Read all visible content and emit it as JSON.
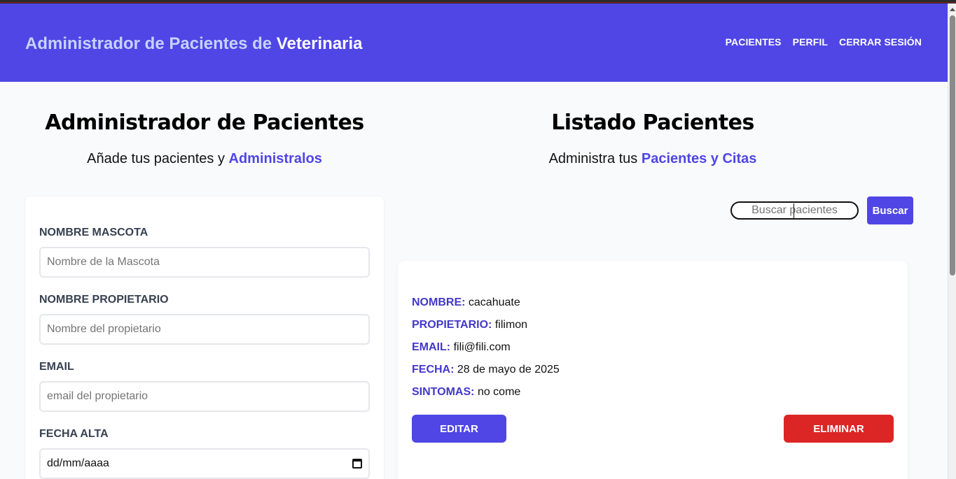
{
  "header": {
    "brand_prefix": "Administrador de Pacientes de ",
    "brand_strong": "Veterinaria",
    "nav": [
      "Pacientes",
      "Perfil",
      "Cerrar Sesión"
    ]
  },
  "left": {
    "title": "Administrador de Pacientes",
    "subtitle_prefix": "Añade tus pacientes y ",
    "subtitle_accent": "Administralos",
    "form": {
      "fields": [
        {
          "label": "Nombre Mascota",
          "placeholder": "Nombre de la Mascota"
        },
        {
          "label": "Nombre Propietario",
          "placeholder": "Nombre del propietario"
        },
        {
          "label": "Email",
          "placeholder": "email del propietario"
        },
        {
          "label": "Fecha Alta",
          "value": "dd/mm/aaaa"
        }
      ]
    }
  },
  "right": {
    "title": "Listado Pacientes",
    "subtitle_prefix": "Administra tus ",
    "subtitle_accent": "Pacientes y Citas",
    "search": {
      "placeholder": "Buscar pacientes",
      "button": "Buscar"
    },
    "patient": {
      "rows": [
        {
          "key": "Nombre:",
          "value": "cacahuate"
        },
        {
          "key": "Propietario:",
          "value": "filimon"
        },
        {
          "key": "Email:",
          "value": "fili@fili.com"
        },
        {
          "key": "Fecha:",
          "value": "28 de mayo de 2025"
        },
        {
          "key": "Sintomas:",
          "value": "no come"
        }
      ],
      "edit_label": "Editar",
      "delete_label": "Eliminar"
    }
  },
  "colors": {
    "primary": "#4f46e5",
    "danger": "#dc2626",
    "label": "#4338ca"
  }
}
